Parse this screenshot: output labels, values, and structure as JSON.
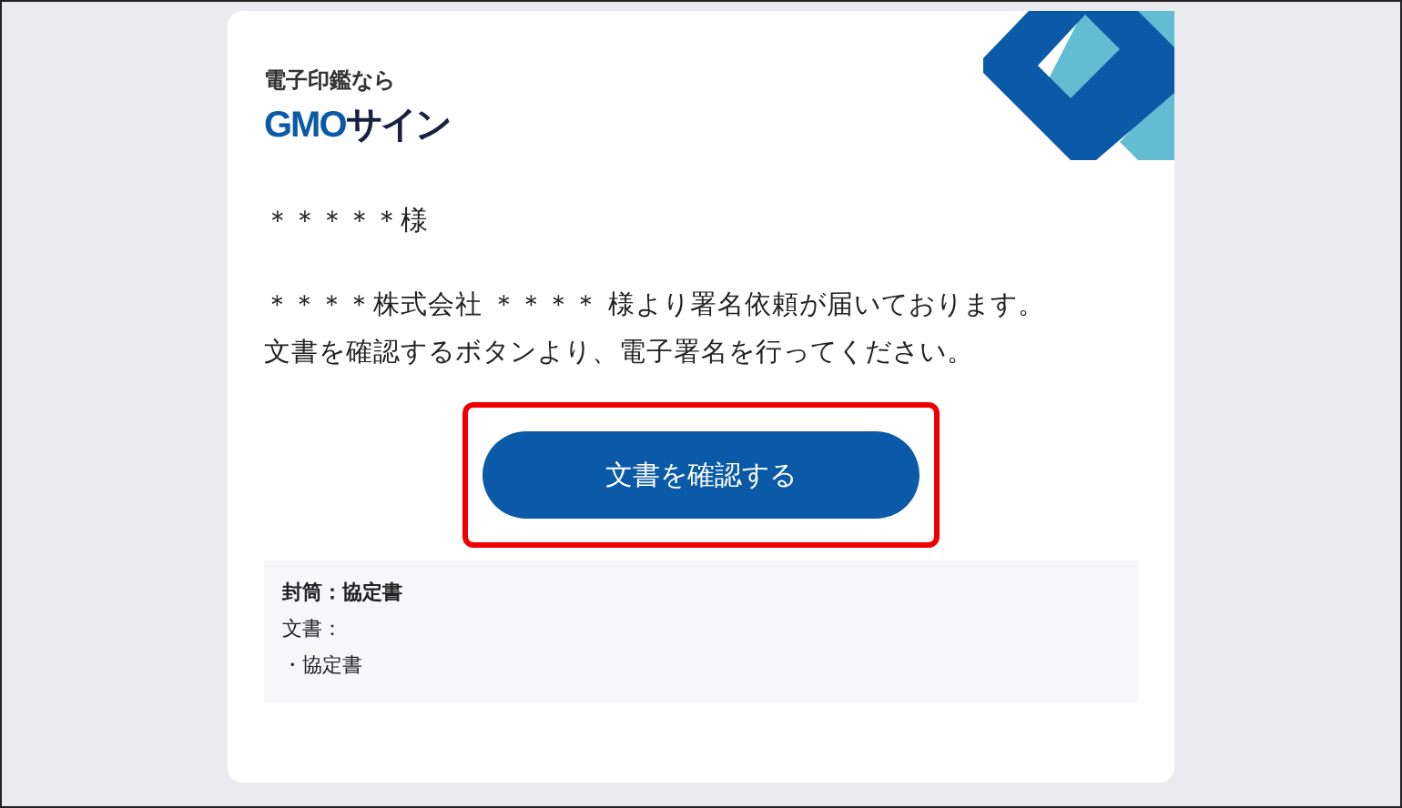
{
  "logo": {
    "tagline": "電子印鑑なら",
    "brand_latin": "GMO",
    "brand_kana": "サイン"
  },
  "greeting": "＊＊＊＊＊様",
  "message": [
    "＊＊＊＊株式会社 ＊＊＊＊ 様より署名依頼が届いております。",
    "文書を確認するボタンより、電子署名を行ってください。"
  ],
  "button": {
    "label": "文書を確認する",
    "highlighted": true
  },
  "details": {
    "envelope": "封筒：協定書",
    "documents_label": "文書：",
    "documents": [
      "・協定書"
    ]
  }
}
